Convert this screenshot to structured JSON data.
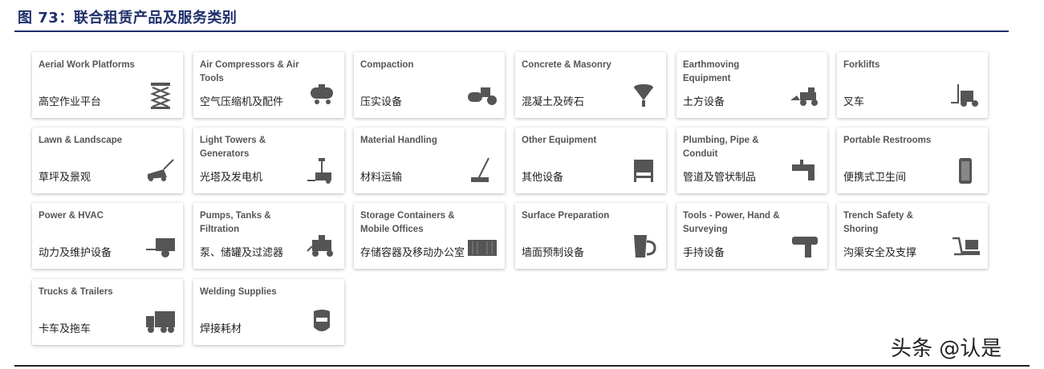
{
  "figure": {
    "title": "图 73：联合租赁产品及服务类别"
  },
  "watermark": "头条 @认是",
  "cards": [
    {
      "en": "Aerial Work Platforms",
      "cn": "高空作业平台",
      "icon": "scissor-lift-icon"
    },
    {
      "en": "Air Compressors & Air Tools",
      "cn": "空气压缩机及配件",
      "icon": "air-compressor-icon"
    },
    {
      "en": "Compaction",
      "cn": "压实设备",
      "icon": "roller-compactor-icon"
    },
    {
      "en": "Concrete & Masonry",
      "cn": "混凝土及砖石",
      "icon": "concrete-hopper-icon"
    },
    {
      "en": "Earthmoving Equipment",
      "cn": "土方设备",
      "icon": "loader-icon"
    },
    {
      "en": "Forklifts",
      "cn": "叉车",
      "icon": "forklift-icon"
    },
    {
      "en": "Lawn & Landscape",
      "cn": "草坪及景观",
      "icon": "lawn-mower-icon"
    },
    {
      "en": "Light Towers & Generators",
      "cn": "光塔及发电机",
      "icon": "light-tower-icon"
    },
    {
      "en": "Material Handling",
      "cn": "材料运输",
      "icon": "crane-icon"
    },
    {
      "en": "Other Equipment",
      "cn": "其他设备",
      "icon": "equipment-cart-icon"
    },
    {
      "en": "Plumbing, Pipe & Conduit",
      "cn": "管道及管状制品",
      "icon": "faucet-icon"
    },
    {
      "en": "Portable Restrooms",
      "cn": "便携式卫生间",
      "icon": "portable-toilet-icon"
    },
    {
      "en": "Power & HVAC",
      "cn": "动力及维护设备",
      "icon": "generator-trailer-icon"
    },
    {
      "en": "Pumps, Tanks & Filtration",
      "cn": "泵、储罐及过滤器",
      "icon": "pump-icon"
    },
    {
      "en": "Storage Containers & Mobile Offices",
      "cn": "存储容器及移动办公室",
      "icon": "container-icon"
    },
    {
      "en": "Surface Preparation",
      "cn": "墙面预制设备",
      "icon": "bucket-icon"
    },
    {
      "en": "Tools - Power, Hand & Surveying",
      "cn": "手持设备",
      "icon": "drill-icon"
    },
    {
      "en": "Trench Safety & Shoring",
      "cn": "沟渠安全及支撑",
      "icon": "trench-box-icon"
    },
    {
      "en": "Trucks & Trailers",
      "cn": "卡车及拖车",
      "icon": "truck-icon"
    },
    {
      "en": "Welding Supplies",
      "cn": "焊接耗材",
      "icon": "welding-mask-icon"
    }
  ]
}
